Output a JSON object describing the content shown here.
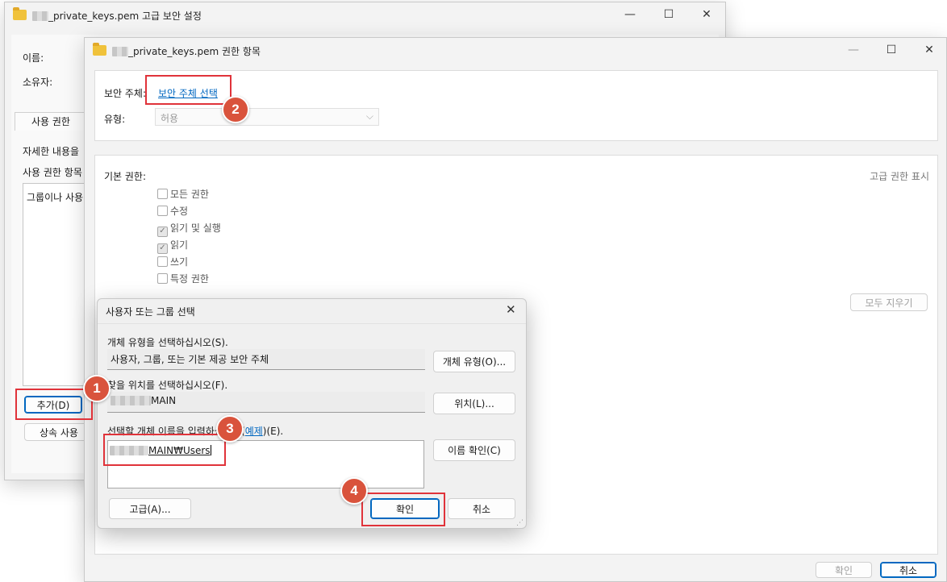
{
  "back_window": {
    "title": "_private_keys.pem 고급 보안 설정",
    "name_label": "이름:",
    "owner_label": "소유자:",
    "tab_permissions": "사용 권한",
    "details_text": "자세한 내용을",
    "perm_entries_label": "사용 권한 항목",
    "list_text": "그룹이나 사용",
    "add_button": "추가(D)",
    "inherit_button": "상속 사용"
  },
  "mid_window": {
    "title": "_private_keys.pem 권한 항목",
    "principal_label": "보안 주체:",
    "select_principal_link": "보안 주체 선택",
    "type_label": "유형:",
    "type_value": "허용",
    "basic_perms_label": "기본 권한:",
    "show_advanced_link": "고급 권한 표시",
    "permissions": [
      {
        "label": "모든 권한",
        "checked": false
      },
      {
        "label": "수정",
        "checked": false
      },
      {
        "label": "읽기 및 실행",
        "checked": true
      },
      {
        "label": "읽기",
        "checked": true
      },
      {
        "label": "쓰기",
        "checked": false
      },
      {
        "label": "특정 권한",
        "checked": false
      }
    ],
    "clear_all_button": "모두 지우기",
    "ok_button": "확인",
    "cancel_button": "취소"
  },
  "dialog": {
    "title": "사용자 또는 그룹 선택",
    "object_type_label": "개체 유형을 선택하십시오(S).",
    "object_type_value": "사용자, 그룹, 또는 기본 제공 보안 주체",
    "object_types_button": "개체 유형(O)...",
    "location_label": "찾을 위치를 선택하십시오(F).",
    "location_value": "MAIN",
    "locations_button": "위치(L)...",
    "names_label_prefix": "선택할 개체 이름을 입력하십시오(",
    "names_link": "예제",
    "names_label_suffix": ")(E).",
    "names_value": "MAIN₩Users",
    "check_names_button": "이름 확인(C)",
    "advanced_button": "고급(A)...",
    "ok_button": "확인",
    "cancel_button": "취소"
  },
  "badges": [
    "1",
    "2",
    "3",
    "4"
  ],
  "colors": {
    "highlight": "#e0333a",
    "badge": "#d9533c",
    "link": "#0067c0"
  }
}
